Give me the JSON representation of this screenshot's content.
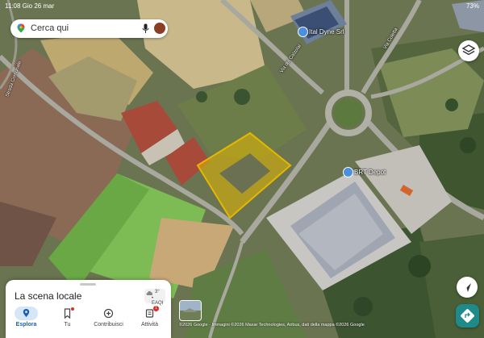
{
  "status_bar": {
    "time": "11:08",
    "date": "Gio 26 mar",
    "battery": "73%"
  },
  "search": {
    "placeholder": "Cerca qui"
  },
  "places": [
    {
      "name": "Ital Dyne Srl",
      "category": "business"
    },
    {
      "name": "BRT Depot",
      "category": "business"
    }
  ],
  "roads": [
    {
      "name": "Via dei Calzolai"
    },
    {
      "name": "Via Coletta"
    },
    {
      "name": "Strada Comunale"
    }
  ],
  "bottom_sheet": {
    "title": "La scena locale",
    "aqi": {
      "value": "3°",
      "label": "• EAQI"
    },
    "tabs": [
      {
        "label": "Esplora",
        "icon": "location-pin-icon",
        "active": true
      },
      {
        "label": "Tu",
        "icon": "saved-icon",
        "active": false
      },
      {
        "label": "Contribuisci",
        "icon": "add-circle-icon",
        "active": false
      },
      {
        "label": "Attività",
        "icon": "notifications-icon",
        "active": false,
        "badge": "1"
      }
    ]
  },
  "attribution": "©2026 Google · Immagini ©2026 Maxar Technologies, Airbus, dati della mappa ©2026 Google",
  "colors": {
    "accent": "#1a5fb4",
    "highlight": "#e5b800",
    "fab": "#1f8a8a"
  }
}
